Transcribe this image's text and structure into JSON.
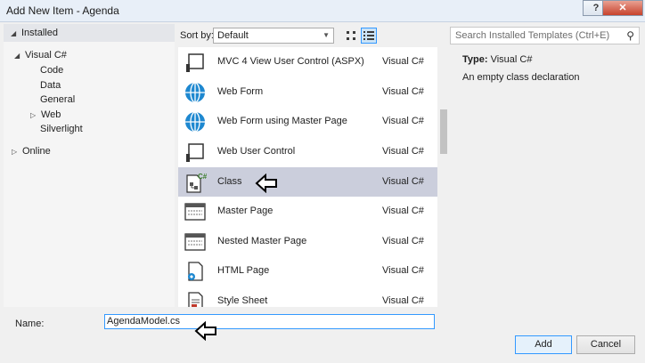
{
  "window": {
    "title": "Add New Item - Agenda",
    "help_label": "?",
    "close_label": "✕"
  },
  "tree": {
    "installed_label": "Installed",
    "items": [
      {
        "label": "Visual C#",
        "arrow": "◢"
      },
      {
        "label": "Code",
        "arrow": ""
      },
      {
        "label": "Data",
        "arrow": ""
      },
      {
        "label": "General",
        "arrow": ""
      },
      {
        "label": "Web",
        "arrow": "▷"
      },
      {
        "label": "Silverlight",
        "arrow": ""
      },
      {
        "label": "Online",
        "arrow": "▷"
      }
    ]
  },
  "toolbar": {
    "sort_label": "Sort by:",
    "sort_value": "Default"
  },
  "search": {
    "placeholder": "Search Installed Templates (Ctrl+E)",
    "icon": "search-icon"
  },
  "templates": [
    {
      "name": "MVC 4 View User Control (ASPX)",
      "lang": "Visual C#",
      "icon": "user-control-icon"
    },
    {
      "name": "Web Form",
      "lang": "Visual C#",
      "icon": "globe-icon"
    },
    {
      "name": "Web Form using Master Page",
      "lang": "Visual C#",
      "icon": "globe-icon"
    },
    {
      "name": "Web User Control",
      "lang": "Visual C#",
      "icon": "user-control-icon"
    },
    {
      "name": "Class",
      "lang": "Visual C#",
      "icon": "class-icon",
      "selected": true
    },
    {
      "name": "Master Page",
      "lang": "Visual C#",
      "icon": "master-page-icon"
    },
    {
      "name": "Nested Master Page",
      "lang": "Visual C#",
      "icon": "master-page-icon"
    },
    {
      "name": "HTML Page",
      "lang": "Visual C#",
      "icon": "html-page-icon"
    },
    {
      "name": "Style Sheet",
      "lang": "Visual C#",
      "icon": "style-sheet-icon"
    }
  ],
  "info": {
    "type_label": "Type:",
    "type_value": "Visual C#",
    "description": "An empty class declaration"
  },
  "name_field": {
    "label": "Name:",
    "value": "AgendaModel.cs"
  },
  "buttons": {
    "add": "Add",
    "cancel": "Cancel"
  },
  "colors": {
    "selection": "#cbcedc",
    "focus_border": "#3399ff",
    "globe": "#1e88d0"
  }
}
